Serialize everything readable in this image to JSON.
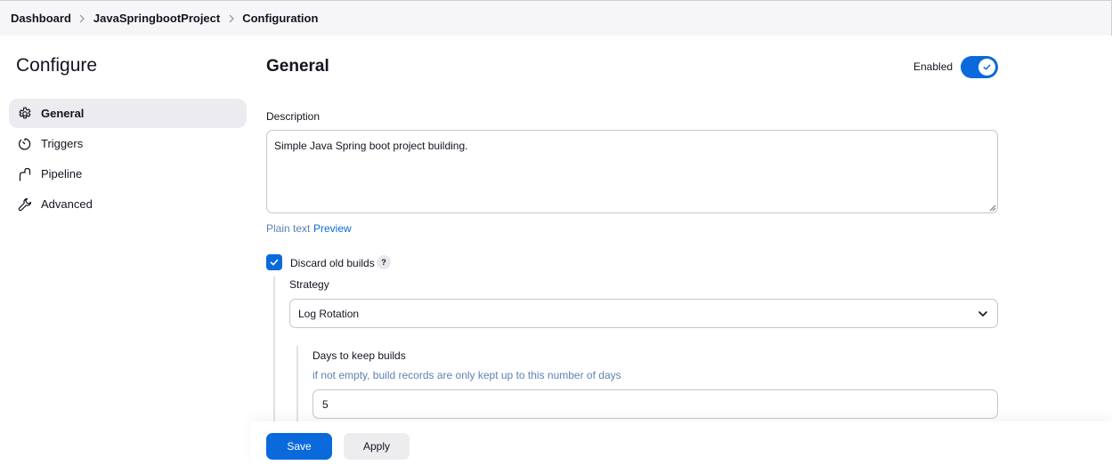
{
  "breadcrumb": [
    "Dashboard",
    "JavaSpringbootProject",
    "Configuration"
  ],
  "sidebar": {
    "title": "Configure",
    "items": [
      {
        "label": "General",
        "icon": "gear-icon",
        "active": true
      },
      {
        "label": "Triggers",
        "icon": "timer-icon",
        "active": false
      },
      {
        "label": "Pipeline",
        "icon": "pipeline-icon",
        "active": false
      },
      {
        "label": "Advanced",
        "icon": "wrench-icon",
        "active": false
      }
    ]
  },
  "general": {
    "title": "General",
    "enabled_label": "Enabled",
    "enabled": true,
    "description_label": "Description",
    "description_value": "Simple Java Spring boot project building.",
    "plain_text_link": "Plain text",
    "preview_link": "Preview",
    "discard_label": "Discard old builds",
    "discard_checked": true,
    "help_glyph": "?",
    "strategy_label": "Strategy",
    "strategy_value": "Log Rotation",
    "days_label": "Days to keep builds",
    "days_hint": "if not empty, build records are only kept up to this number of days",
    "days_value": "5"
  },
  "actions": {
    "save": "Save",
    "apply": "Apply"
  },
  "colors": {
    "accent": "#0b6adb",
    "hint": "#5e81b5",
    "active_bg": "#ececf0"
  }
}
